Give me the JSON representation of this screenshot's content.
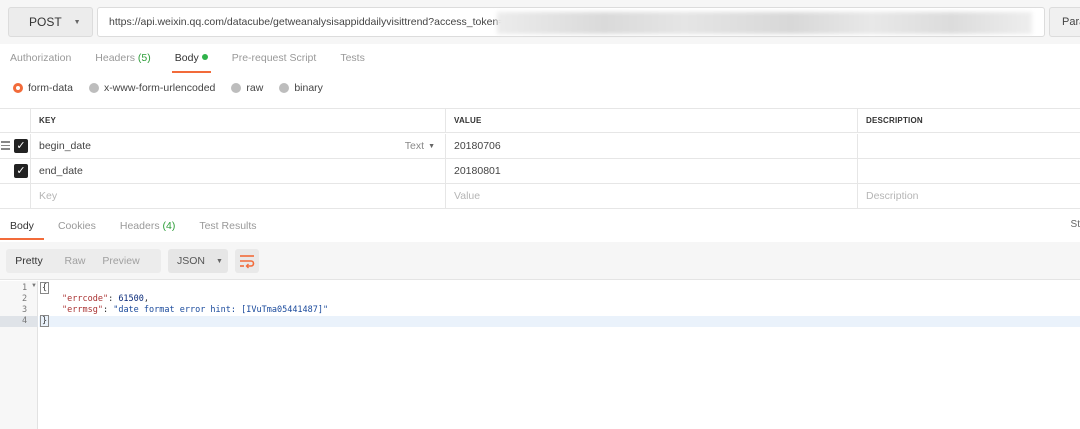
{
  "request": {
    "method": "POST",
    "url": "https://api.weixin.qq.com/datacube/getweanalysisappiddailyvisittrend?access_token=",
    "params_label": "Para"
  },
  "request_tabs": [
    {
      "label": "Authorization",
      "count": "",
      "active": false
    },
    {
      "label": "Headers",
      "count": "(5)",
      "active": false
    },
    {
      "label": "Body",
      "count": "",
      "active": true
    },
    {
      "label": "Pre-request Script",
      "count": "",
      "active": false
    },
    {
      "label": "Tests",
      "count": "",
      "active": false
    }
  ],
  "body_types": [
    {
      "label": "form-data",
      "selected": true
    },
    {
      "label": "x-www-form-urlencoded",
      "selected": false
    },
    {
      "label": "raw",
      "selected": false
    },
    {
      "label": "binary",
      "selected": false
    }
  ],
  "params_table": {
    "headers": {
      "key": "KEY",
      "value": "VALUE",
      "description": "DESCRIPTION"
    },
    "rows": [
      {
        "key": "begin_date",
        "type": "Text",
        "value": "20180706",
        "description": ""
      },
      {
        "key": "end_date",
        "type": "",
        "value": "20180801",
        "description": ""
      }
    ],
    "placeholder": {
      "key": "Key",
      "value": "Value",
      "description": "Description"
    }
  },
  "response_tabs": [
    {
      "label": "Body",
      "count": "",
      "active": true
    },
    {
      "label": "Cookies",
      "count": "",
      "active": false
    },
    {
      "label": "Headers",
      "count": "(4)",
      "active": false
    },
    {
      "label": "Test Results",
      "count": "",
      "active": false
    }
  ],
  "status_label": "St",
  "view_modes": [
    {
      "label": "Pretty",
      "active": true
    },
    {
      "label": "Raw",
      "active": false
    },
    {
      "label": "Preview",
      "active": false
    }
  ],
  "format": "JSON",
  "response_code": {
    "line_numbers": [
      "1",
      "2",
      "3",
      "4"
    ],
    "errcode_key": "\"errcode\"",
    "errcode_value": "61500",
    "errmsg_key": "\"errmsg\"",
    "errmsg_value": "\"date format error hint: [IVuTma05441487]\""
  },
  "colors": {
    "accent": "#f26b3a",
    "count_green": "#2e9e3a",
    "dot_green": "#2fb24a"
  }
}
